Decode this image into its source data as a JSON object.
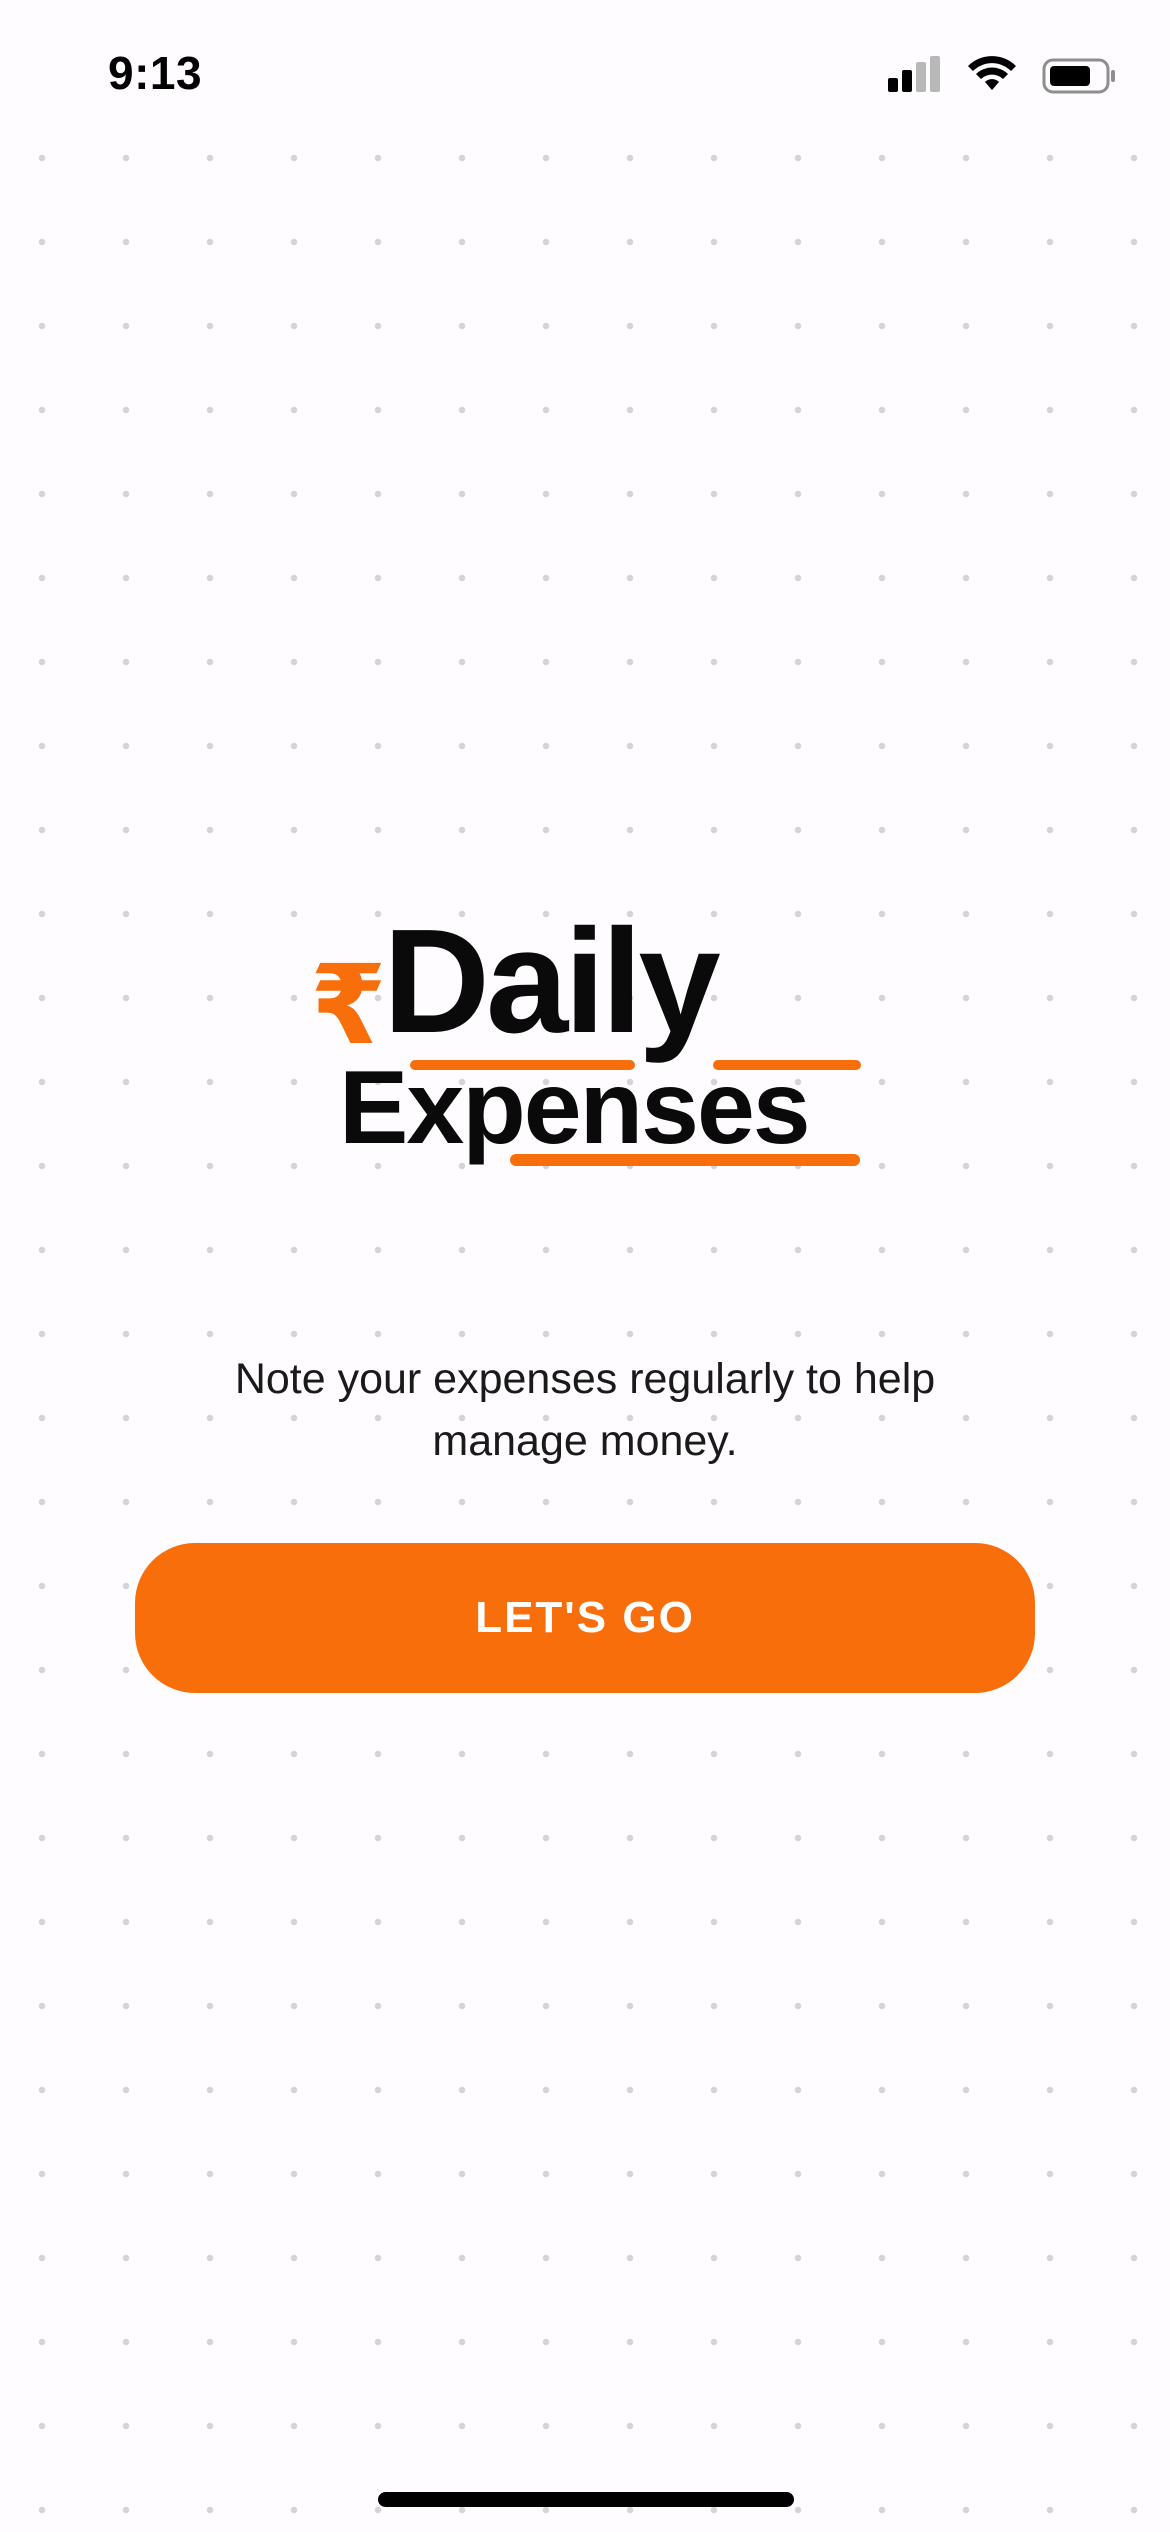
{
  "status_bar": {
    "time": "9:13",
    "icons": [
      "cellular-signal-icon",
      "wifi-icon",
      "battery-icon"
    ]
  },
  "logo": {
    "symbol": "₹",
    "line1": "Daily",
    "line2": "Expenses",
    "accent_color": "#f86e0b",
    "text_color": "#0a0a0a"
  },
  "tagline": "Note your expenses regularly to help manage money.",
  "cta": {
    "label": "LET'S GO",
    "color": "#f86e0b"
  }
}
